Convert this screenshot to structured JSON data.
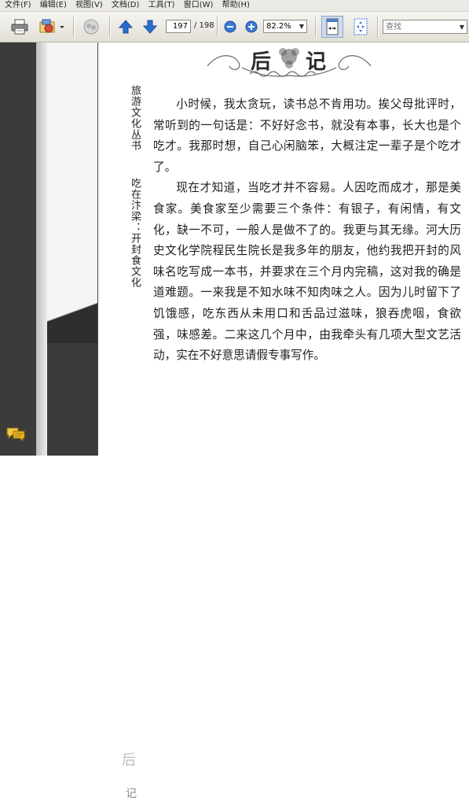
{
  "menu": {
    "items": [
      "文件(F)",
      "编辑(E)",
      "视图(V)",
      "文档(D)",
      "工具(T)",
      "窗口(W)",
      "帮助(H)"
    ]
  },
  "toolbar": {
    "current_page": "197",
    "total_pages": "/ 198",
    "zoom": "82.2%",
    "search_placeholder": "查找"
  },
  "icons": {
    "print": "print-icon",
    "email": "email-icon",
    "collaborate": "collaborate-icon",
    "prev": "arrow-up-icon",
    "next": "arrow-down-icon",
    "zoom_out": "zoom-out-icon",
    "zoom_in": "zoom-in-icon",
    "fit_width": "fit-width-icon",
    "fit_page": "fit-page-icon",
    "comment": "comment-icon"
  },
  "colors": {
    "toolbar_bg": "#e2dfd6",
    "nav_panel": "#3b3b3b",
    "arrow_blue": "#2a6fd0",
    "text": "#1e1e1e"
  },
  "page": {
    "series": "旅游文化丛书",
    "book_title": "吃在汴梁：开封食文化",
    "heading": "后记",
    "sidebar_chapter": "后",
    "sidebar_chapter2": "记",
    "paragraphs": [
      "小时候，我太贪玩，读书总不肯用功。挨父母批评时，常听到的一句话是：不好好念书，就没有本事，长大也是个吃才。我那时想，自己心闲脑笨，大概注定一辈子是个吃才了。",
      "现在才知道，当吃才并不容易。人因吃而成才，那是美食家。美食家至少需要三个条件：有银子，有闲情，有文化，缺一不可，一般人是做不了的。我更与其无缘。河大历史文化学院程民生院长是我多年的朋友，他约我把开封的风味名吃写成一本书，并要求在三个月内完稿，这对我的确是道难题。一来我是不知水味不知肉味之人。因为儿时留下了饥饿感，吃东西从未用口和舌品过滋味，狼吞虎咽，食欲强，味感差。二来这几个月中，由我牵头有几项大型文艺活动，实在不好意思请假专事写作。"
    ]
  }
}
